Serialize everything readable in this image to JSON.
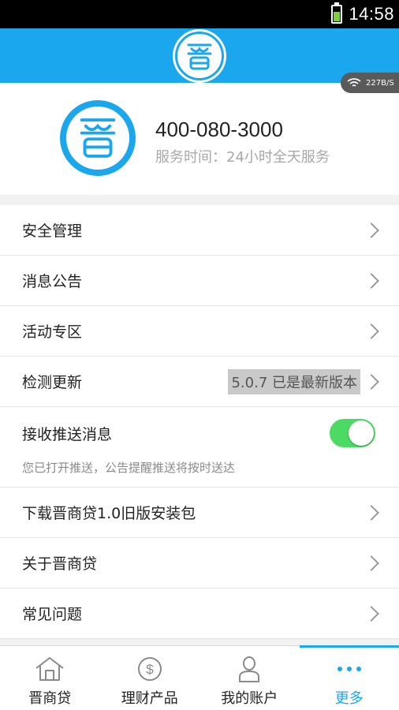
{
  "status_bar": {
    "time": "14:58"
  },
  "speed_indicator": "227B/S",
  "header": {
    "logo_icon": "jin-logo-icon"
  },
  "contact": {
    "phone": "400-080-3000",
    "service_time": "服务时间：24小时全天服务"
  },
  "menu": {
    "security": "安全管理",
    "notices": "消息公告",
    "events": "活动专区",
    "update": "检测更新",
    "version_status": "5.0.7 已是最新版本",
    "push_label": "接收推送消息",
    "push_hint": "您已打开推送，公告提醒推送将按时送达",
    "download_old": "下载晋商贷1.0旧版安装包",
    "about": "关于晋商贷",
    "faq": "常见问题"
  },
  "tabs": [
    {
      "label": "晋商贷",
      "icon": "home-icon"
    },
    {
      "label": "理财产品",
      "icon": "dollar-icon"
    },
    {
      "label": "我的账户",
      "icon": "user-icon"
    },
    {
      "label": "更多",
      "icon": "more-dots-icon"
    }
  ],
  "colors": {
    "brand": "#1ba7ee",
    "toggle_on": "#4cd964"
  }
}
